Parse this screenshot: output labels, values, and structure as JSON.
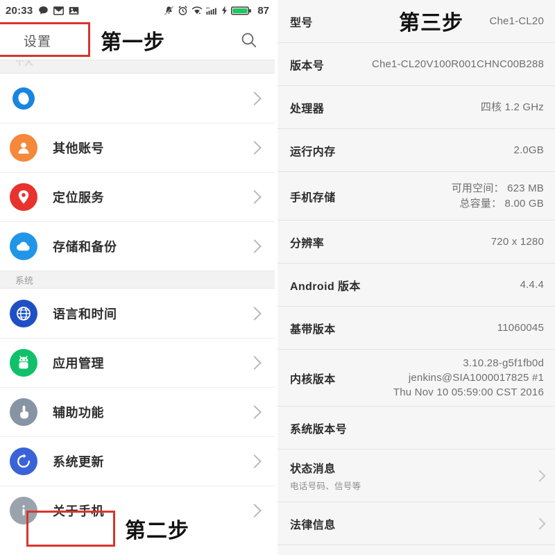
{
  "statusbar": {
    "time": "20:33",
    "battery_percent": "87",
    "left_icons": [
      "chat-bubble-icon",
      "envelope-icon",
      "screenshot-icon"
    ],
    "right_icons": [
      "mute-bell-icon",
      "alarm-clock-icon",
      "wifi-icon",
      "signal-4g-icon",
      "charging-bolt-icon",
      "battery-icon"
    ],
    "battery_color": "#22c55e"
  },
  "left_panel": {
    "title": "设置",
    "search_icon": "search-icon",
    "section_personal": "个人",
    "section_system": "系统",
    "items_personal": [
      {
        "label": "",
        "icon": "theme-ring-icon",
        "color": "#1a85e0"
      },
      {
        "label": "其他账号",
        "icon": "person-icon",
        "color": "#f5883a"
      },
      {
        "label": "定位服务",
        "icon": "location-pin-icon",
        "color": "#e8322d"
      },
      {
        "label": "存储和备份",
        "icon": "cloud-icon",
        "color": "#2196e8"
      }
    ],
    "items_system": [
      {
        "label": "语言和时间",
        "icon": "globe-icon",
        "color": "#1e4fc4"
      },
      {
        "label": "应用管理",
        "icon": "android-robot-icon",
        "color": "#11c06a"
      },
      {
        "label": "辅助功能",
        "icon": "hand-pointer-icon",
        "color": "#8794a3"
      },
      {
        "label": "系统更新",
        "icon": "refresh-icon",
        "color": "#3a63d8"
      },
      {
        "label": "关于手机",
        "icon": "info-icon",
        "color": "#9aa3ac"
      }
    ]
  },
  "right_panel": {
    "rows": [
      {
        "key": "型号",
        "value": "Che1-CL20",
        "sub": "",
        "chevron": false
      },
      {
        "key": "版本号",
        "value": "Che1-CL20V100R001CHNC00B288",
        "sub": "",
        "chevron": false
      },
      {
        "key": "处理器",
        "value": "四核 1.2 GHz",
        "sub": "",
        "chevron": false
      },
      {
        "key": "运行内存",
        "value": "2.0GB",
        "sub": "",
        "chevron": false
      },
      {
        "key": "手机存储",
        "value": "可用空间： 623 MB\n总容量： 8.00 GB",
        "sub": "",
        "chevron": false
      },
      {
        "key": "分辨率",
        "value": "720 x 1280",
        "sub": "",
        "chevron": false
      },
      {
        "key": "Android 版本",
        "value": "4.4.4",
        "sub": "",
        "chevron": false
      },
      {
        "key": "基带版本",
        "value": "11060045",
        "sub": "",
        "chevron": false
      },
      {
        "key": "内核版本",
        "value": "3.10.28-g5f1fb0d\njenkins@SIA1000017825 #1\nThu Nov 10 05:59:00 CST 2016",
        "sub": "",
        "chevron": false
      },
      {
        "key": "系统版本号",
        "value": "",
        "sub": "",
        "chevron": false
      },
      {
        "key": "状态消息",
        "value": "",
        "sub": "电话号码、信号等",
        "chevron": true
      },
      {
        "key": "法律信息",
        "value": "",
        "sub": "",
        "chevron": true
      }
    ]
  },
  "annotations": {
    "step1": "第一步",
    "step2": "第二步",
    "step3": "第三步",
    "highlight_color": "#d9342b"
  }
}
